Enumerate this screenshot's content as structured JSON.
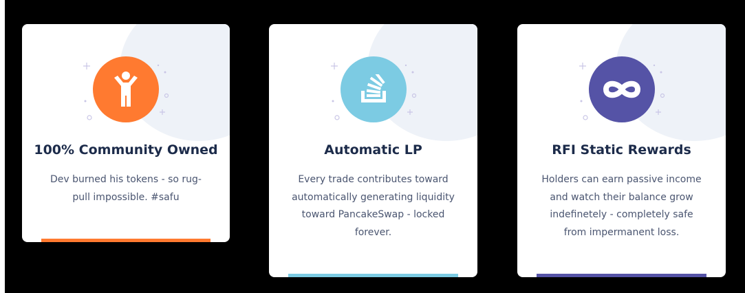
{
  "colors": {
    "orange": "#ff7a30",
    "light_blue": "#7ccbe3",
    "purple": "#5553a6",
    "title": "#1c2b4a",
    "body": "#4a5570"
  },
  "cards": [
    {
      "icon": "person-arms-up-icon",
      "title": "100% Community Owned",
      "lines": [
        "Dev burned his tokens - so rug-",
        "pull impossible. #safu"
      ]
    },
    {
      "icon": "stack-inbox-icon",
      "title": "Automatic LP",
      "lines": [
        "Every trade contributes toward",
        "automatically generating liquidity",
        "toward PancakeSwap - locked",
        "forever."
      ]
    },
    {
      "icon": "infinity-icon",
      "title": "RFI Static Rewards",
      "lines": [
        "Holders can earn passive income",
        "and watch their balance grow",
        "indefinetely - completely safe",
        "from impermanent loss."
      ]
    }
  ]
}
